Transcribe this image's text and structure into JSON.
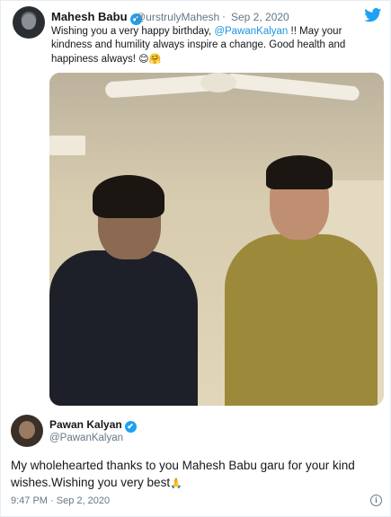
{
  "quoted_tweet": {
    "author_name": "Mahesh Babu",
    "verified_glyph": "✔",
    "handle": "@urstrulyMahesh",
    "separator": "·",
    "date": "Sep 2, 2020",
    "text_before_mention": "Wishing you a very happy birthday, ",
    "mention": "@PawanKalyan",
    "text_after_mention": " !! May your kindness and humility always inspire a change. Good health and happiness always! ",
    "emojis": "😊🤗",
    "brand_icon": "twitter-bird-icon",
    "brand_color": "#1da1f2"
  },
  "reply_tweet": {
    "author_name": "Pawan Kalyan",
    "verified_glyph": "✔",
    "handle": "@PawanKalyan",
    "text": "My wholehearted thanks to you Mahesh Babu garu for your kind wishes.Wishing you very best",
    "emoji": "🙏",
    "timestamp": "9:47 PM · Sep 2, 2020",
    "info_glyph": "i"
  },
  "colors": {
    "link": "#1b95e0",
    "secondary_text": "#657786",
    "verified": "#1da1f2"
  }
}
